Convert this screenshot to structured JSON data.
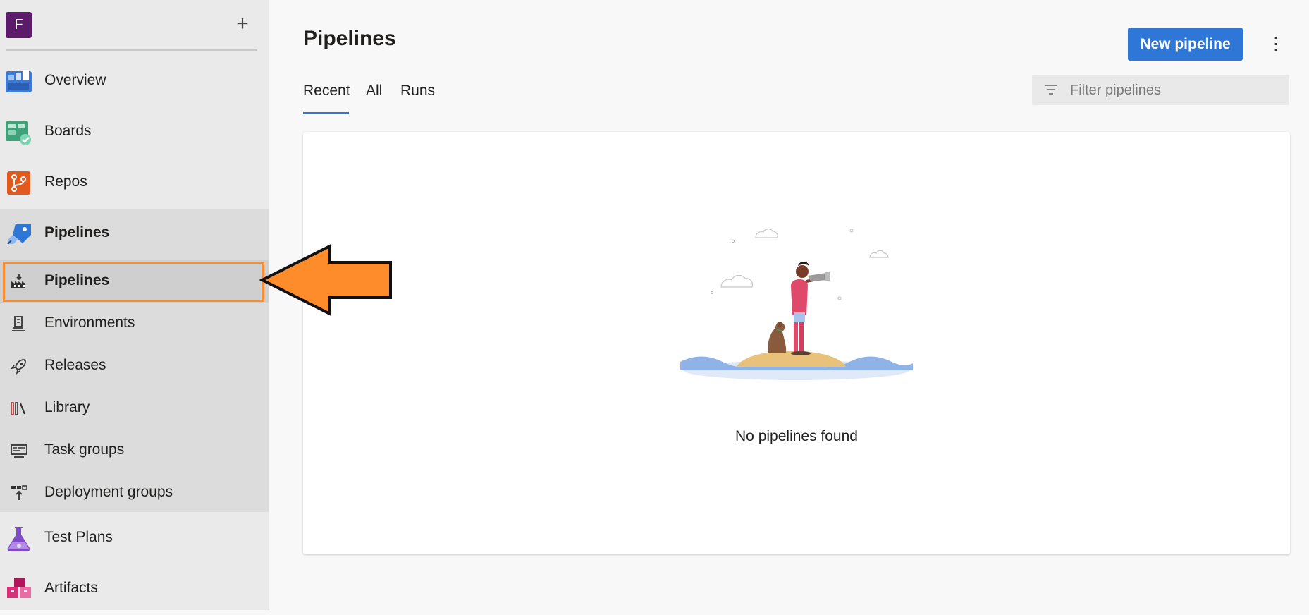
{
  "org": {
    "avatar_letter": "F",
    "add_icon": "plus-icon"
  },
  "nav": {
    "overview": "Overview",
    "boards": "Boards",
    "repos": "Repos",
    "pipelines": "Pipelines",
    "sub": {
      "pipelines": "Pipelines",
      "environments": "Environments",
      "releases": "Releases",
      "library": "Library",
      "task_groups": "Task groups",
      "deployment_groups": "Deployment groups"
    },
    "test_plans": "Test Plans",
    "artifacts": "Artifacts"
  },
  "main": {
    "title": "Pipelines",
    "new_button": "New pipeline",
    "more_icon": "⋮",
    "tabs": [
      "Recent",
      "All",
      "Runs"
    ],
    "active_tab": "Recent",
    "filter_placeholder": "Filter pipelines",
    "empty_message": "No pipelines found"
  },
  "colors": {
    "accent": "#2f77d6",
    "highlight": "#ff8c2a",
    "org_avatar": "#5c1a6b"
  }
}
